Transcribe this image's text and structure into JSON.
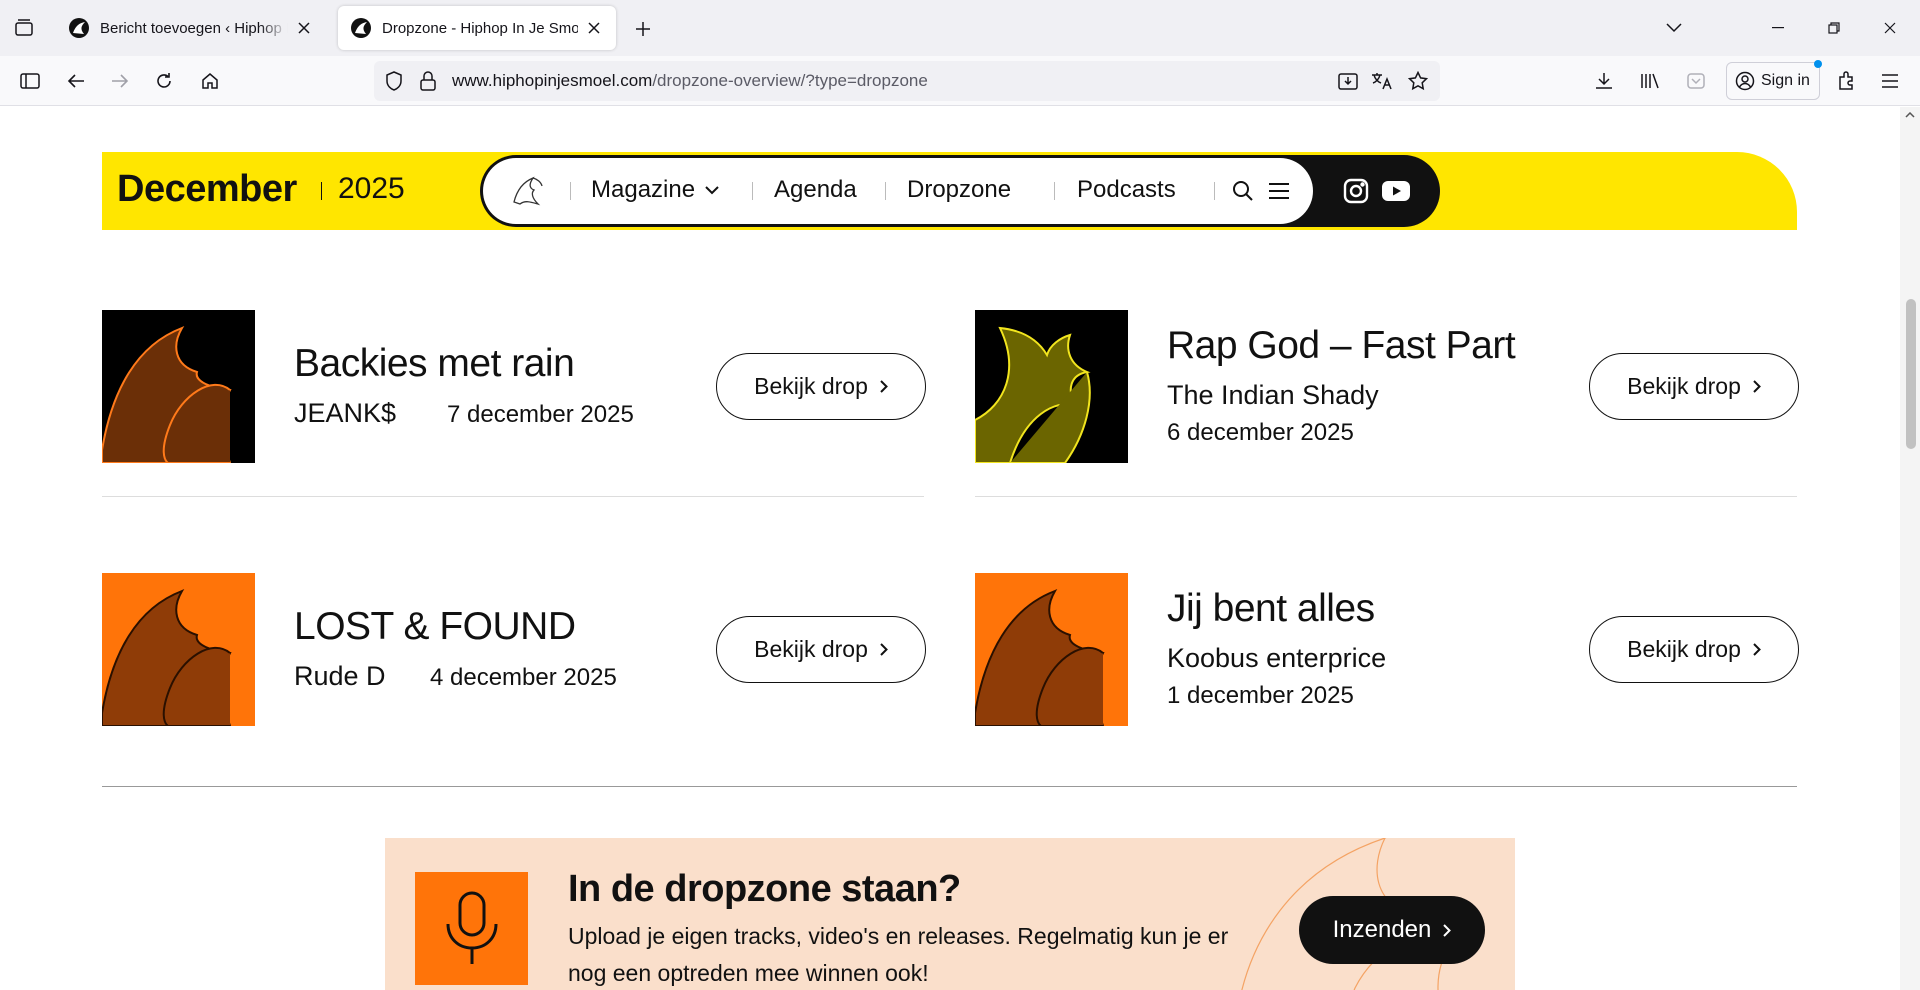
{
  "browser": {
    "tabs": [
      {
        "title": "Bericht toevoegen ‹ Hiphop In Je Smoel",
        "active": false
      },
      {
        "title": "Dropzone - Hiphop In Je Smoel",
        "active": true
      }
    ],
    "url_host": "www.hiphopinjesmoel.com",
    "url_path": "/dropzone-overview/?type=dropzone",
    "signin_label": "Sign in"
  },
  "header": {
    "month": "December",
    "year": "2025",
    "nav": {
      "magazine": "Magazine",
      "agenda": "Agenda",
      "dropzone": "Dropzone",
      "podcasts": "Podcasts"
    }
  },
  "drops": [
    {
      "title": "Backies met rain",
      "artist": "JEANK$",
      "date": "7 december 2025",
      "button": "Bekijk drop",
      "thumb_bg": "#000000",
      "thumb_fg": "#6b2f07",
      "thumb_stroke": "#ff7a1a"
    },
    {
      "title": "Rap God – Fast Part",
      "artist": "The Indian Shady",
      "date": "6 december 2025",
      "button": "Bekijk drop",
      "thumb_bg": "#000000",
      "thumb_fg": "#6b6500",
      "thumb_stroke": "#f2e51e"
    },
    {
      "title": "LOST & FOUND",
      "artist": "Rude D",
      "date": "4 december 2025",
      "button": "Bekijk drop",
      "thumb_bg": "#ff7409",
      "thumb_fg": "#8f3c07",
      "thumb_stroke": "#2a1000"
    },
    {
      "title": "Jij bent alles",
      "artist": "Koobus enterprice",
      "date": "1 december 2025",
      "button": "Bekijk drop",
      "thumb_bg": "#ff7409",
      "thumb_fg": "#8f3c07",
      "thumb_stroke": "#2a1000"
    }
  ],
  "cta": {
    "title": "In de dropzone staan?",
    "text": "Upload je eigen tracks, video's en releases. Regelmatig kun je er nog een optreden mee winnen ook!",
    "button": "Inzenden",
    "icon": "microphone-icon"
  },
  "colors": {
    "brand_yellow": "#ffe600",
    "brand_orange": "#ff7409",
    "cta_background": "#fadfcb",
    "dark": "#111111"
  }
}
